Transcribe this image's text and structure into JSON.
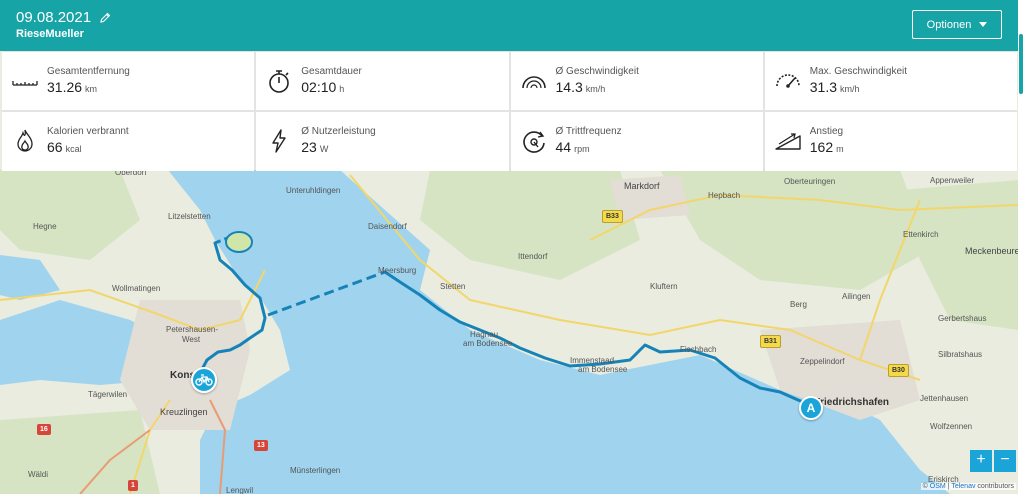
{
  "header": {
    "date": "09.08.2021",
    "bike_name": "RieseMueller",
    "options_label": "Optionen"
  },
  "stats": [
    {
      "label": "Gesamtentfernung",
      "value": "31.26",
      "unit": "km",
      "icon": "ruler-icon"
    },
    {
      "label": "Gesamtdauer",
      "value": "02:10",
      "unit": "h",
      "icon": "stopwatch-icon"
    },
    {
      "label": "Ø Geschwindigkeit",
      "value": "14.3",
      "unit": "km/h",
      "icon": "speedometer-icon"
    },
    {
      "label": "Max. Geschwindigkeit",
      "value": "31.3",
      "unit": "km/h",
      "icon": "max-speedometer-icon"
    },
    {
      "label": "Kalorien verbrannt",
      "value": "66",
      "unit": "kcal",
      "icon": "flame-icon"
    },
    {
      "label": "Ø Nutzerleistung",
      "value": "23",
      "unit": "W",
      "icon": "lightning-icon"
    },
    {
      "label": "Ø Trittfrequenz",
      "value": "44",
      "unit": "rpm",
      "icon": "cadence-icon"
    },
    {
      "label": "Anstieg",
      "value": "162",
      "unit": "m",
      "icon": "incline-icon"
    }
  ],
  "map": {
    "places": [
      {
        "name": "Oberdorf",
        "cls": ""
      },
      {
        "name": "Litzelstetten",
        "cls": ""
      },
      {
        "name": "Hegne",
        "cls": ""
      },
      {
        "name": "Wollmatingen",
        "cls": ""
      },
      {
        "name": "Petershausen-",
        "cls": ""
      },
      {
        "name": "West",
        "cls": ""
      },
      {
        "name": "Konstanz",
        "cls": "big"
      },
      {
        "name": "Tägerwilen",
        "cls": ""
      },
      {
        "name": "Kreuzlingen",
        "cls": "mid"
      },
      {
        "name": "Unteruhldingen",
        "cls": ""
      },
      {
        "name": "Daisendorf",
        "cls": ""
      },
      {
        "name": "Meersburg",
        "cls": ""
      },
      {
        "name": "Stetten",
        "cls": ""
      },
      {
        "name": "Ittendorf",
        "cls": ""
      },
      {
        "name": "Hagnau",
        "cls": ""
      },
      {
        "name": "am Bodensee",
        "cls": ""
      },
      {
        "name": "Immenstaad",
        "cls": ""
      },
      {
        "name": "am Bodensee",
        "cls": ""
      },
      {
        "name": "Markdorf",
        "cls": "mid"
      },
      {
        "name": "Hepbach",
        "cls": ""
      },
      {
        "name": "Kluftern",
        "cls": ""
      },
      {
        "name": "Fischbach",
        "cls": ""
      },
      {
        "name": "Oberteuringen",
        "cls": ""
      },
      {
        "name": "Appenweiler",
        "cls": ""
      },
      {
        "name": "Ettenkirch",
        "cls": ""
      },
      {
        "name": "Meckenbeuren",
        "cls": "mid"
      },
      {
        "name": "Berg",
        "cls": ""
      },
      {
        "name": "Ailingen",
        "cls": ""
      },
      {
        "name": "Gerbertshaus",
        "cls": ""
      },
      {
        "name": "Zeppelindorf",
        "cls": ""
      },
      {
        "name": "Friedrichshafen",
        "cls": "big"
      },
      {
        "name": "Silbratshaus",
        "cls": ""
      },
      {
        "name": "Jettenhausen",
        "cls": ""
      },
      {
        "name": "Wolfzennen",
        "cls": ""
      },
      {
        "name": "Eriskirch",
        "cls": ""
      },
      {
        "name": "Münsterlingen",
        "cls": ""
      },
      {
        "name": "Wäldi",
        "cls": ""
      },
      {
        "name": "Lengwil",
        "cls": ""
      }
    ],
    "shields": [
      {
        "text": "B33",
        "cls": "yellow"
      },
      {
        "text": "B31",
        "cls": "yellow"
      },
      {
        "text": "B30",
        "cls": "yellow"
      },
      {
        "text": "16",
        "cls": "red"
      },
      {
        "text": "13",
        "cls": "red"
      },
      {
        "text": "1",
        "cls": "red"
      }
    ],
    "marker_a_label": "A",
    "zoom_in": "+",
    "zoom_out": "−",
    "attribution_prefix": "©",
    "attribution_osm": "OSM",
    "attribution_sep": "|",
    "attribution_telenav": "Telenav",
    "attribution_suffix": "contributors"
  }
}
